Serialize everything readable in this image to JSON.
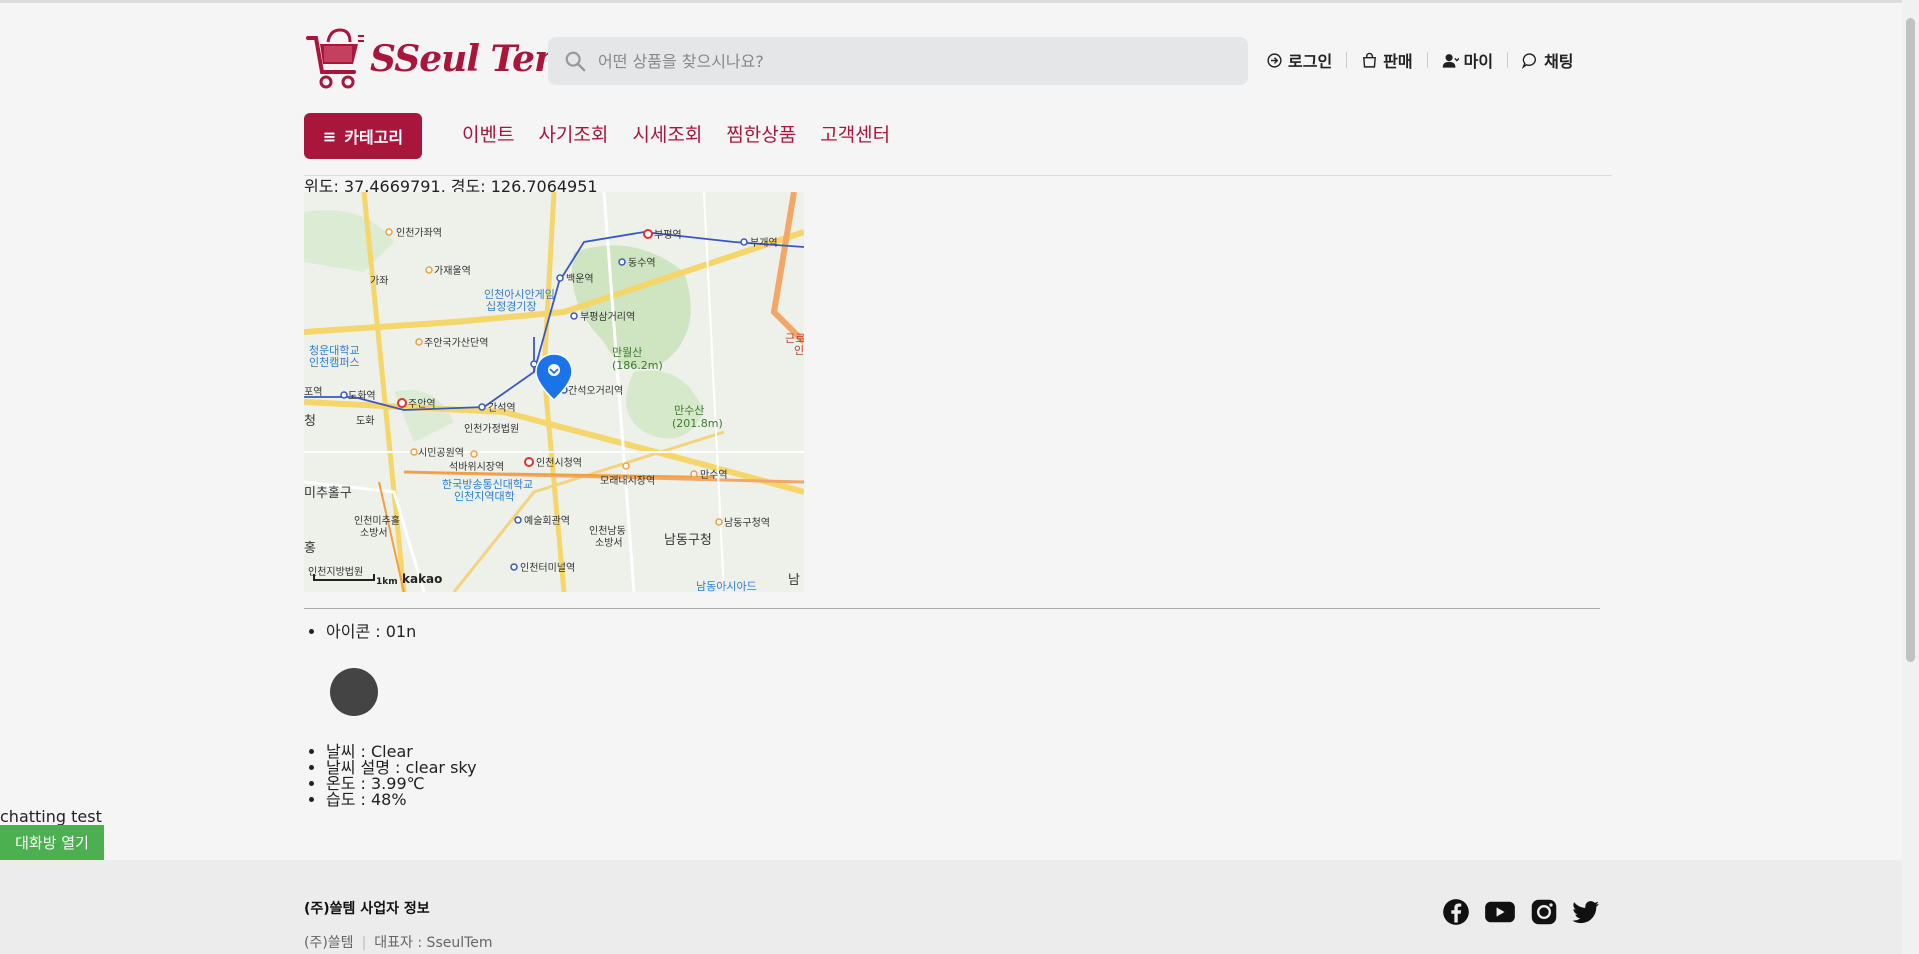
{
  "brand": {
    "name": "SSeul Tem",
    "color": "#a8163c"
  },
  "search": {
    "placeholder": "어떤 상품을 찾으시나요?"
  },
  "user_menu": [
    {
      "label": "로그인",
      "icon": "login-icon"
    },
    {
      "label": "판매",
      "icon": "shopping-bag-icon"
    },
    {
      "label": "마이",
      "icon": "user-icon"
    },
    {
      "label": "채팅",
      "icon": "chat-icon"
    }
  ],
  "category_button": {
    "label": "카테고리",
    "icon": "hamburger-icon"
  },
  "nav": [
    "이벤트",
    "사기조회",
    "시세조회",
    "찜한상품",
    "고객센터"
  ],
  "location": {
    "text": "위도: 37.4669791, 경도: 126.7064951"
  },
  "map": {
    "provider": "kakao",
    "scale": "1km",
    "labels": {
      "bupyeong": "부평역",
      "bugae": "부개역",
      "dongsu": "동수역",
      "baegun": "백운역",
      "bupyeong3": "부평삼거리역",
      "manwolsan": "만월산",
      "manwolsan_h": "(186.2m)",
      "mansusan": "만수산",
      "mansusan_h": "(201.8m)",
      "gajwa": "가좌",
      "gajaeul": "가재울역",
      "incheongajwa": "인천가좌역",
      "asiad": "인천아시안게임",
      "asiad2": "십정경기장",
      "juan_ind": "주안국가산단역",
      "cheongun": "청운대학교",
      "cheongun2": "인천캠퍼스",
      "dohwa": "도화역",
      "juan": "주안역",
      "ganseok": "간석역",
      "ganseok5": "간석오거리역",
      "court": "인천가정법원",
      "citypark": "시민공원역",
      "seokbawi": "석바위시장역",
      "cityhall": "인천시청역",
      "moraenae": "모래내시장역",
      "mansu": "만수역",
      "kbtu": "한국방송통신대학교",
      "kbtu2": "인천지역대학",
      "michuhol": "인천미추홀",
      "michuhol2": "소방서",
      "artscenter": "예술회관역",
      "namdong_fire": "인천남동",
      "namdong_fire2": "소방서",
      "namdong_office": "남동구청",
      "namdong_station": "남동구청역",
      "terminal": "인천터미널역",
      "district_court": "인천지방법원",
      "michuholgu": "미추홀구",
      "namdong_asiad": "남동아시아드",
      "geunro": "근로",
      "in": "인",
      "yeok": "포역",
      "cheong": "청",
      "hong": "홍",
      "nam": "남",
      "dohwa_ic": "도화"
    }
  },
  "weather": {
    "icon_label": "아이콘 : 01n",
    "items": [
      "날씨 : Clear",
      "날씨 설명 : clear sky",
      "온도 : 3.99℃",
      "습도 : 48%"
    ]
  },
  "chat": {
    "label": "chatting test",
    "button": "대화방 열기",
    "button_color": "#4caf50"
  },
  "footer": {
    "title": "(주)쓸템 사업자 정보",
    "company": "(주)쓸템",
    "ceo": "대표자 : SseulTem",
    "social": [
      "facebook-icon",
      "youtube-icon",
      "instagram-icon",
      "twitter-icon"
    ]
  }
}
